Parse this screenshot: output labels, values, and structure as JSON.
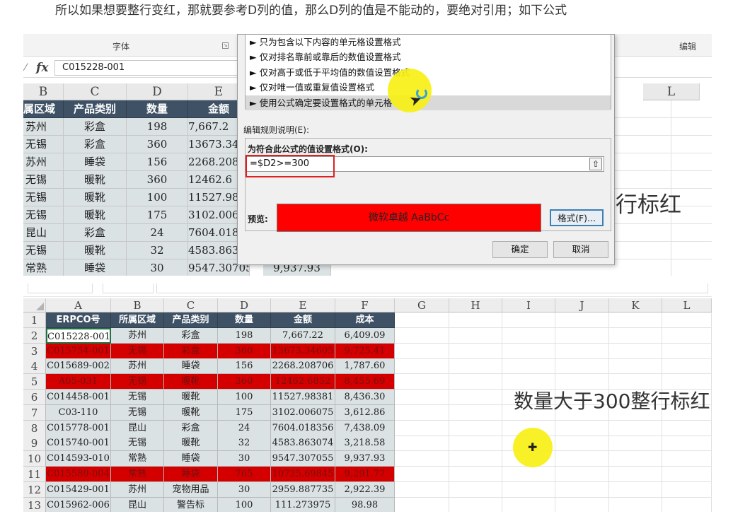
{
  "caption": "所以如果想要整行变红，那就要参考D列的值，那么D列的值是不能动的，要绝对引用；如下公式",
  "top": {
    "ribbon": {
      "font_group": "字体",
      "edit_group": "编辑"
    },
    "formula_bar": {
      "value": "C015228-001"
    },
    "columns": [
      "B",
      "C",
      "D",
      "E",
      "L"
    ],
    "table_header": [
      "属区域",
      "产品类别",
      "数量",
      "金额"
    ],
    "rows": [
      [
        "苏州",
        "彩盒",
        "198",
        "7,667.2"
      ],
      [
        "无锡",
        "彩盒",
        "360",
        "13673.34"
      ],
      [
        "苏州",
        "睡袋",
        "156",
        "2268.208"
      ],
      [
        "无锡",
        "暖靴",
        "360",
        "12462.6"
      ],
      [
        "无锡",
        "暖靴",
        "100",
        "11527.98"
      ],
      [
        "无锡",
        "暖靴",
        "175",
        "3102.006"
      ],
      [
        "昆山",
        "彩盒",
        "24",
        "7604.018"
      ],
      [
        "无锡",
        "暖靴",
        "32",
        "4583.863"
      ],
      [
        "常熟",
        "睡袋",
        "30",
        "9547.307055"
      ]
    ],
    "extra_cell": "9,937.93",
    "right_annotation": "行标红",
    "dialog": {
      "rule_types": [
        "► 只为包含以下内容的单元格设置格式",
        "► 仅对排名靠前或靠后的数值设置格式",
        "► 仅对高于或低于平均值的数值设置格式",
        "► 仅对唯一值或重复值设置格式",
        "► 使用公式确定要设置格式的单元格"
      ],
      "edit_rule_label": "编辑规则说明(E):",
      "formula_label": "为符合此公式的值设置格式(O):",
      "formula_value": "=$D2>=300",
      "preview_label": "预览:",
      "preview_text": "微软卓越  AaBbCc",
      "format_button": "格式(F)...",
      "ok_button": "确定",
      "cancel_button": "取消",
      "colors": {
        "preview_fill": "#ff0000",
        "highlight_outline": "#e02020"
      }
    }
  },
  "bottom": {
    "columns": [
      "A",
      "B",
      "C",
      "D",
      "E",
      "F",
      "G",
      "H",
      "I",
      "J",
      "K",
      "L"
    ],
    "row_numbers": [
      "1",
      "2",
      "3",
      "4",
      "5",
      "6",
      "7",
      "8",
      "9",
      "10",
      "11",
      "12",
      "13"
    ],
    "header": [
      "ERPCO号",
      "所属区域",
      "产品类别",
      "数量",
      "金额",
      "成本"
    ],
    "rows": [
      {
        "cells": [
          "C015228-001",
          "苏州",
          "彩盒",
          "198",
          "7,667.22",
          "6,409.09"
        ],
        "highlight": false
      },
      {
        "cells": [
          "C015754-001",
          "无锡",
          "彩盒",
          "360",
          "13673.34605",
          "9,725.41"
        ],
        "highlight": true
      },
      {
        "cells": [
          "C015689-002",
          "苏州",
          "睡袋",
          "156",
          "2268.208706",
          "1,787.60"
        ],
        "highlight": false
      },
      {
        "cells": [
          "A05-031",
          "无锡",
          "暖靴",
          "360",
          "12462.6852",
          "8,455.69"
        ],
        "highlight": true
      },
      {
        "cells": [
          "C014458-001",
          "无锡",
          "暖靴",
          "100",
          "11527.98381",
          "8,436.30"
        ],
        "highlight": false
      },
      {
        "cells": [
          "C03-110",
          "无锡",
          "暖靴",
          "175",
          "3102.006075",
          "3,612.86"
        ],
        "highlight": false
      },
      {
        "cells": [
          "C015778-001",
          "昆山",
          "彩盒",
          "24",
          "7604.018356",
          "7,438.09"
        ],
        "highlight": false
      },
      {
        "cells": [
          "C015740-001",
          "无锡",
          "暖靴",
          "32",
          "4583.863074",
          "3,218.58"
        ],
        "highlight": false
      },
      {
        "cells": [
          "C014593-010",
          "常熟",
          "睡袋",
          "30",
          "9547.307055",
          "9,937.93"
        ],
        "highlight": false
      },
      {
        "cells": [
          "C015589-004",
          "常熟",
          "睡袋",
          "765",
          "10725.69845",
          "9,291.77"
        ],
        "highlight": true
      },
      {
        "cells": [
          "C015429-001",
          "苏州",
          "宠物用品",
          "30",
          "2959.887735",
          "2,922.39"
        ],
        "highlight": false
      },
      {
        "cells": [
          "C015962-006",
          "昆山",
          "警告标",
          "100",
          "111.273975",
          "98.98"
        ],
        "highlight": false
      }
    ],
    "annotation": "数量大于300整行标红",
    "colors": {
      "header_fill": "#3f5265",
      "body_fill": "#dbe2e4",
      "highlight_fill": "#d40000"
    }
  }
}
